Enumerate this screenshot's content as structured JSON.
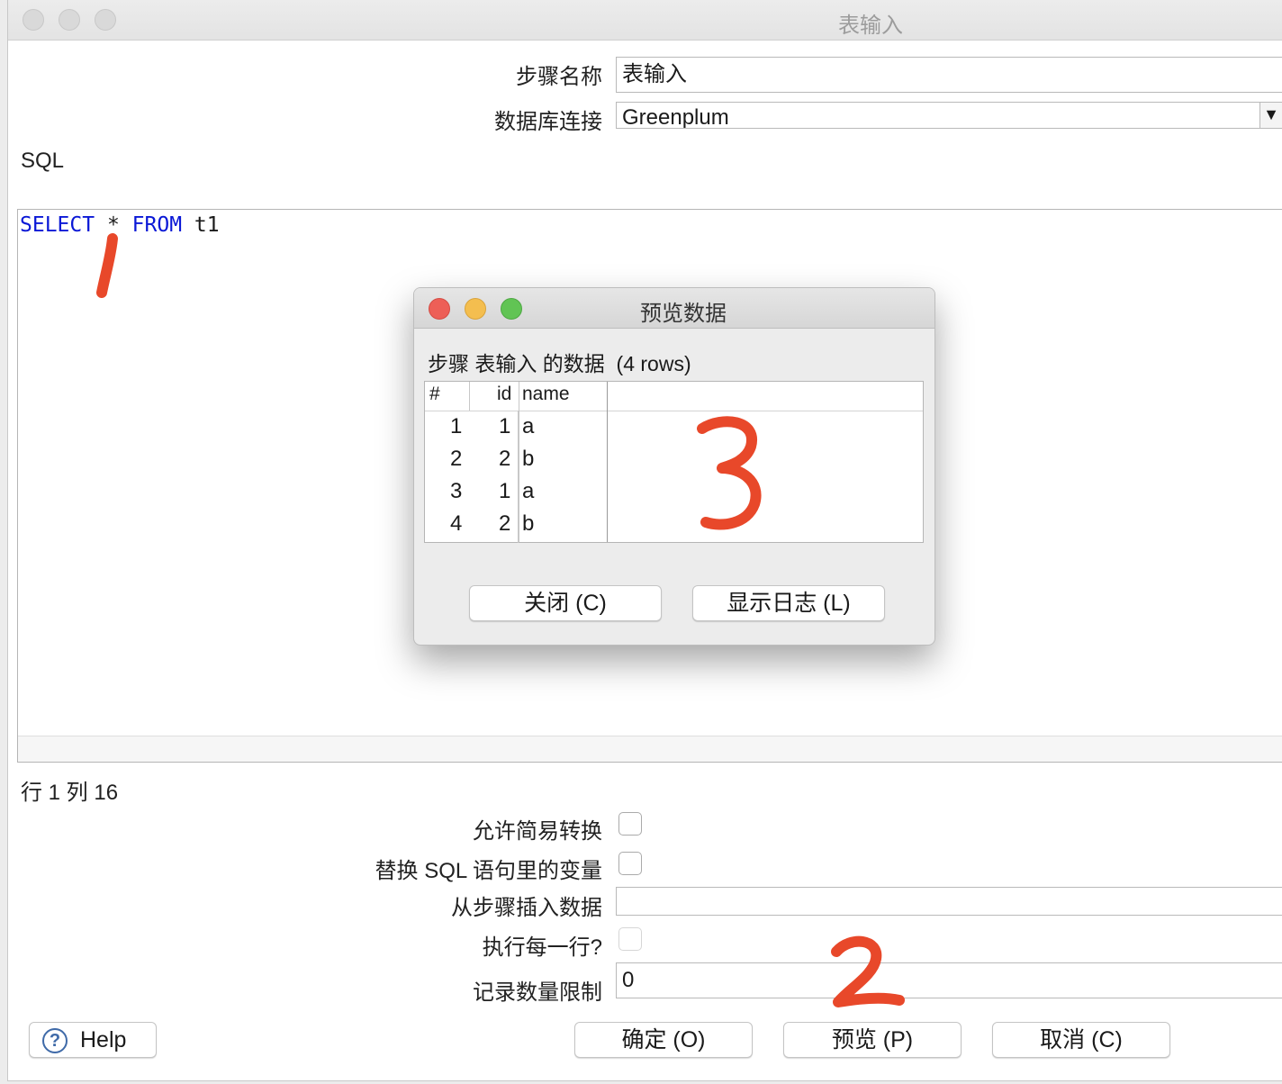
{
  "window": {
    "title": "表输入"
  },
  "form": {
    "step_name_label": "步骤名称",
    "step_name_value": "表输入",
    "db_conn_label": "数据库连接",
    "db_conn_value": "Greenplum",
    "sql_label": "SQL",
    "sql": {
      "kw1": "SELECT",
      "star": "*",
      "kw2": "FROM",
      "table": "t1"
    },
    "cursor_pos": "行 1 列 16",
    "lazy_label": "允许简易转换",
    "replace_vars_label": "替换 SQL 语句里的变量",
    "insert_from_step_label": "从步骤插入数据",
    "insert_from_step_value": "",
    "execute_each_row_label": "执行每一行?",
    "limit_label": "记录数量限制",
    "limit_value": "0"
  },
  "buttons": {
    "help": "Help",
    "ok": "确定 (O)",
    "preview": "预览 (P)",
    "cancel": "取消 (C)"
  },
  "annotations": {
    "one": "1",
    "two": "2",
    "three": "3",
    "color": "#e8482a"
  },
  "dialog": {
    "title": "预览数据",
    "caption": "步骤 表输入 的数据  (4 rows)",
    "columns": [
      "#",
      "id",
      "name"
    ],
    "rows": [
      {
        "n": "1",
        "id": "1",
        "name": "a"
      },
      {
        "n": "2",
        "id": "2",
        "name": "b"
      },
      {
        "n": "3",
        "id": "1",
        "name": "a"
      },
      {
        "n": "4",
        "id": "2",
        "name": "b"
      }
    ],
    "close_button": "关闭 (C)",
    "log_button": "显示日志 (L)"
  }
}
